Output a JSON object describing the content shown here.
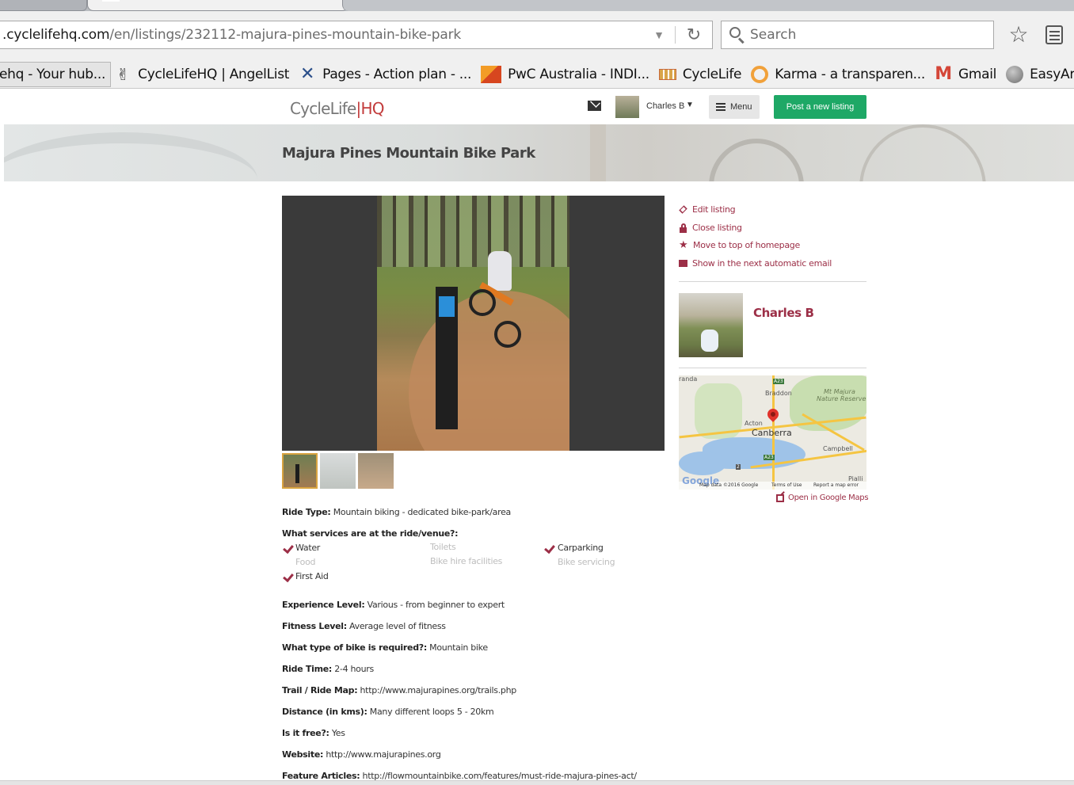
{
  "browser": {
    "url_host": ".cyclelifehq.com",
    "url_path": "/en/listings/232112-majura-pines-mountain-bike-park",
    "search_placeholder": "Search",
    "bookmarks": [
      {
        "label": "ehq - Your hub...",
        "icon": "none"
      },
      {
        "label": "CycleLifeHQ | AngelList",
        "icon": "victory-hand-icon"
      },
      {
        "label": "Pages - Action plan - ...",
        "icon": "tools-x-icon"
      },
      {
        "label": "PwC Australia - INDI...",
        "icon": "pwc-icon"
      },
      {
        "label": "CycleLife",
        "icon": "cyclelife-icon"
      },
      {
        "label": "Karma - a transparen...",
        "icon": "karma-ring-icon"
      },
      {
        "label": "Gmail",
        "icon": "gmail-icon"
      },
      {
        "label": "EasyArmy.com",
        "icon": "globe-icon"
      }
    ]
  },
  "header": {
    "logo_main": "CycleLife",
    "logo_sep": "|",
    "logo_hq": "HQ",
    "user_name": "Charles B",
    "menu_label": "Menu",
    "post_button": "Post a new listing"
  },
  "listing": {
    "title": "Majura Pines Mountain Bike Park"
  },
  "details": {
    "ride_type_label": "Ride Type:",
    "ride_type_value": "Mountain biking - dedicated bike-park/area",
    "services_label": "What services are at the ride/venue?:",
    "services": [
      {
        "label": "Water",
        "checked": true
      },
      {
        "label": "Toilets",
        "checked": false
      },
      {
        "label": "Carparking",
        "checked": true
      },
      {
        "label": "Food",
        "checked": false
      },
      {
        "label": "Bike hire facilities",
        "checked": false
      },
      {
        "label": "Bike servicing",
        "checked": false
      },
      {
        "label": "First Aid",
        "checked": true
      }
    ],
    "fields": [
      {
        "label": "Experience Level:",
        "value": "Various - from beginner to expert"
      },
      {
        "label": "Fitness Level:",
        "value": "Average level of fitness"
      },
      {
        "label": "What type of bike is required?:",
        "value": "Mountain bike"
      },
      {
        "label": "Ride Time:",
        "value": "2-4 hours"
      },
      {
        "label": "Trail / Ride Map:",
        "value": "http://www.majurapines.org/trails.php"
      },
      {
        "label": "Distance (in kms):",
        "value": "Many different loops 5 - 20km"
      },
      {
        "label": "Is it free?:",
        "value": "Yes"
      },
      {
        "label": "Website:",
        "value": "http://www.majurapines.org"
      },
      {
        "label": "Feature Articles:",
        "value": "http://flowmountainbike.com/features/must-ride-majura-pines-act/"
      }
    ]
  },
  "sidebar": {
    "actions": [
      {
        "label": "Edit listing",
        "icon": "pencil-icon"
      },
      {
        "label": "Close listing",
        "icon": "lock-icon"
      },
      {
        "label": "Move to top of homepage",
        "icon": "star-icon"
      },
      {
        "label": "Show in the next automatic email",
        "icon": "envelope-icon"
      }
    ],
    "author_name": "Charles B",
    "map": {
      "labels": [
        "randa",
        "Braddon",
        "Mt Majura",
        "Nature Reserve",
        "Acton",
        "Canberra",
        "Campbell",
        "Pialli",
        "A23",
        "A23",
        "2"
      ],
      "credit_data": "Map data ©2016 Google",
      "credit_terms": "Terms of Use",
      "credit_report": "Report a map error",
      "google": "Google"
    },
    "open_maps": "Open in Google Maps"
  },
  "colors": {
    "accent": "#9c2f47",
    "post_button": "#1ea866",
    "logo_hq": "#c23b3b"
  }
}
